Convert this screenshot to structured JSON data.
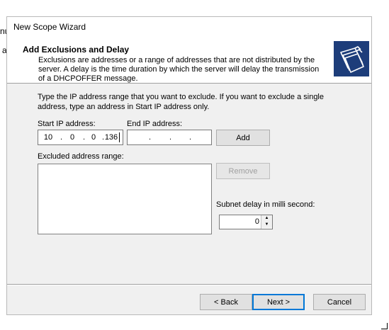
{
  "background": {
    "fragment_top": "nu",
    "fragment_mid": "a"
  },
  "window": {
    "title": "New Scope Wizard"
  },
  "header": {
    "title": "Add Exclusions and Delay",
    "description": "Exclusions are addresses or a range of addresses that are not distributed by the server. A delay is the time duration by which the server will delay the transmission of a DHCPOFFER message.",
    "icon": "folders-icon"
  },
  "body": {
    "instructions": "Type the IP address range that you want to exclude. If you want to exclude a single address, type an address in Start IP address only.",
    "start_ip_label": "Start IP address:",
    "start_ip": {
      "o1": "10",
      "o2": "0",
      "o3": "0",
      "o4": "136"
    },
    "end_ip_label": "End IP address:",
    "end_ip": {
      "o1": "",
      "o2": "",
      "o3": "",
      "o4": ""
    },
    "add_button": "Add",
    "excluded_label": "Excluded address range:",
    "excluded_items": [],
    "remove_button": "Remove",
    "delay_label": "Subnet delay in milli second:",
    "delay_value": "0"
  },
  "footer": {
    "back_button": "< Back",
    "next_button": "Next >",
    "cancel_button": "Cancel"
  },
  "colors": {
    "accent": "#0078d7",
    "window_bg": "#f0f0f0",
    "icon_bg": "#1d3d7a"
  }
}
